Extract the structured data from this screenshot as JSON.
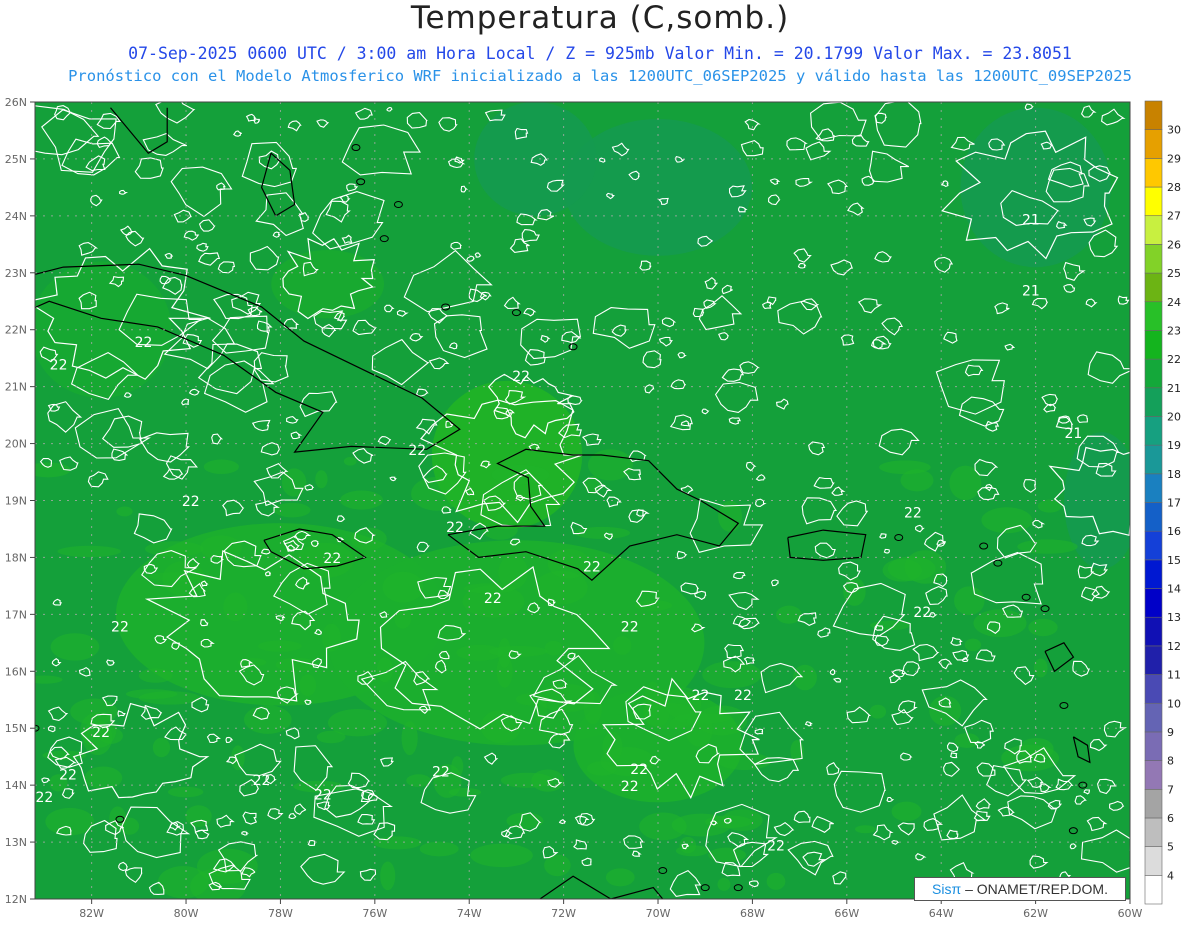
{
  "header": {
    "title": "Temperatura (C,somb.)",
    "line1": "07-Sep-2025  0600 UTC / 3:00 am Hora Local / Z = 925mb    Valor Min. = 20.1799  Valor Max. = 23.8051",
    "line2": "Pronóstico con el Modelo Atmosferico WRF inicializado a las 1200UTC_06SEP2025 y válido hasta las  1200UTC_09SEP2025"
  },
  "map": {
    "lon_range": [
      -83.2,
      -60
    ],
    "lat_range": [
      12,
      26
    ],
    "lat_ticks": [
      "12N",
      "13N",
      "14N",
      "15N",
      "16N",
      "17N",
      "18N",
      "19N",
      "20N",
      "21N",
      "22N",
      "23N",
      "24N",
      "25N",
      "26N"
    ],
    "lon_ticks": [
      "82W",
      "80W",
      "78W",
      "76W",
      "74W",
      "72W",
      "70W",
      "68W",
      "66W",
      "64W",
      "62W",
      "60W"
    ],
    "contour_labels": [
      {
        "text": "22",
        "lon": -82.7,
        "lat": 21.3
      },
      {
        "text": "22",
        "lon": -80.9,
        "lat": 21.7
      },
      {
        "text": "22",
        "lon": -79.9,
        "lat": 18.9
      },
      {
        "text": "22",
        "lon": -75.1,
        "lat": 19.8
      },
      {
        "text": "22",
        "lon": -72.9,
        "lat": 21.1
      },
      {
        "text": "22",
        "lon": -76.9,
        "lat": 17.9
      },
      {
        "text": "22",
        "lon": -74.3,
        "lat": 18.45
      },
      {
        "text": "22",
        "lon": -71.4,
        "lat": 17.75
      },
      {
        "text": "22",
        "lon": -73.5,
        "lat": 17.2
      },
      {
        "text": "22",
        "lon": -81.4,
        "lat": 16.7
      },
      {
        "text": "22",
        "lon": -70.6,
        "lat": 16.7
      },
      {
        "text": "22",
        "lon": -69.1,
        "lat": 15.5
      },
      {
        "text": "22",
        "lon": -68.2,
        "lat": 15.5
      },
      {
        "text": "22",
        "lon": -81.8,
        "lat": 14.85
      },
      {
        "text": "22",
        "lon": -82.5,
        "lat": 14.1
      },
      {
        "text": "22",
        "lon": -83.0,
        "lat": 13.7
      },
      {
        "text": "22",
        "lon": -78.4,
        "lat": 14.0
      },
      {
        "text": "22",
        "lon": -77.1,
        "lat": 13.75
      },
      {
        "text": "22",
        "lon": -74.6,
        "lat": 14.15
      },
      {
        "text": "22",
        "lon": -70.4,
        "lat": 14.2
      },
      {
        "text": "22",
        "lon": -70.6,
        "lat": 13.9
      },
      {
        "text": "22",
        "lon": -67.5,
        "lat": 12.85
      },
      {
        "text": "22",
        "lon": -64.6,
        "lat": 18.7
      },
      {
        "text": "22",
        "lon": -64.4,
        "lat": 16.95
      },
      {
        "text": "21",
        "lon": -62.1,
        "lat": 23.85
      },
      {
        "text": "21",
        "lon": -62.1,
        "lat": 22.6
      },
      {
        "text": "21",
        "lon": -61.2,
        "lat": 20.1
      }
    ]
  },
  "colorbar": {
    "levels": [
      "4",
      "5",
      "6",
      "7",
      "8",
      "9",
      "10",
      "11",
      "12",
      "13",
      "14",
      "15",
      "16",
      "17",
      "18",
      "19",
      "20",
      "21",
      "22",
      "23",
      "24",
      "25",
      "26",
      "27",
      "28",
      "29",
      "30"
    ],
    "colors": [
      "#ffffff",
      "#dcdcdc",
      "#bebebe",
      "#a4a4a4",
      "#9378b4",
      "#7a6cb4",
      "#6464b4",
      "#4a4ab4",
      "#2020aa",
      "#1010b4",
      "#0000c8",
      "#0018d2",
      "#1440d8",
      "#1460c8",
      "#1a80c0",
      "#1a9898",
      "#16a080",
      "#14a05a",
      "#14a83a",
      "#14b41e",
      "#28c028",
      "#6cb414",
      "#82d228",
      "#c8f040",
      "#ffff00",
      "#ffc800",
      "#e6a000",
      "#c88200"
    ]
  },
  "credit": {
    "sis": "Sisπ",
    "org": "– ONAMET/REP.DOM."
  }
}
